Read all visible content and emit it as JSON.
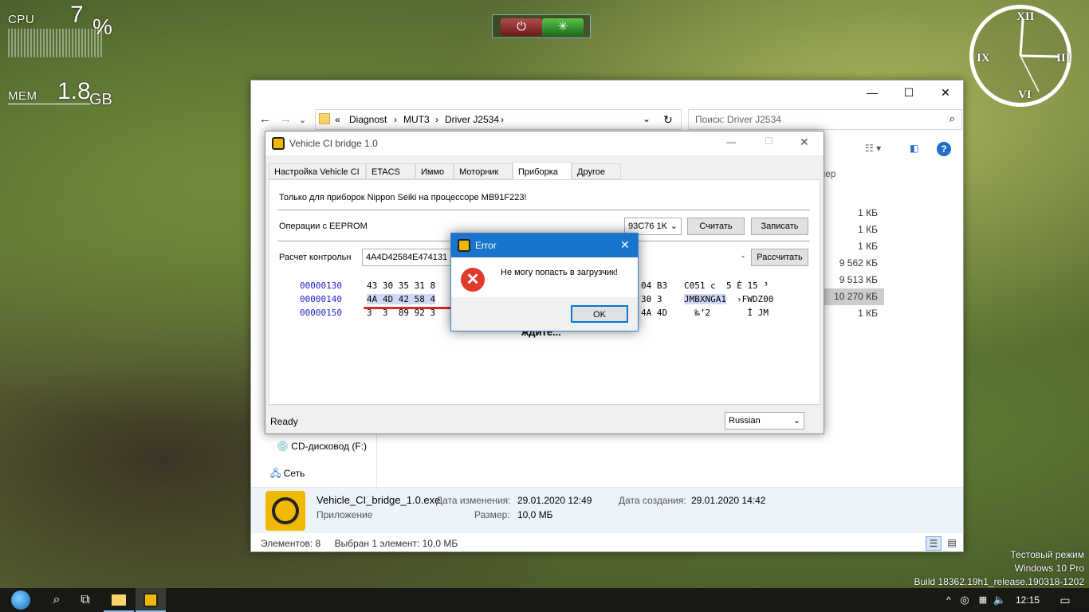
{
  "desktop": {
    "cpu": {
      "label": "CPU",
      "value": "7",
      "unit": "%"
    },
    "mem": {
      "label": "MEM",
      "value": "1.8",
      "unit": "GB"
    },
    "watermark": {
      "line1": "Тестовый режим",
      "line2": "Windows 10 Pro",
      "line3": "Build 18362.19h1_release.190318-1202"
    }
  },
  "explorer": {
    "breadcrumb_prefix": "«",
    "breadcrumb": [
      "Diagnost",
      "MUT3",
      "Driver J2534"
    ],
    "search_placeholder": "Поиск: Driver J2534",
    "col_size_partial": "мер",
    "sizes": [
      "1 КБ",
      "1 КБ",
      "1 КБ",
      "9 562 КБ",
      "9 513 КБ",
      "10 270 КБ",
      "1 КБ"
    ],
    "nav_items": [
      {
        "label": "CD-дисковод (F:)"
      },
      {
        "label": "Сеть"
      }
    ],
    "details": {
      "filename": "Vehicle_CI_bridge_1.0.exe",
      "type": "Приложение",
      "modified_label": "Дата изменения:",
      "modified_value": "29.01.2020 12:49",
      "created_label": "Дата создания:",
      "created_value": "29.01.2020 14:42",
      "size_label": "Размер:",
      "size_value": "10,0 МБ"
    },
    "status": {
      "items": "Элементов: 8",
      "selected": "Выбран 1 элемент: 10,0 МБ"
    }
  },
  "vci": {
    "title": "Vehicle CI bridge  1.0",
    "tabs": [
      "Настройка Vehicle CI",
      "ETACS",
      "Иммо",
      "Моторник",
      "Приборка",
      "Другое"
    ],
    "active_tab": "Приборка",
    "notice": "Только для приборок Nippon Seiki на процессоре MB91F223!",
    "eeprom_label": "Операции с EEPROM",
    "eeprom_chip": "93C76 1K",
    "read_button": "Считать",
    "write_button": "Записать",
    "checksum_label": "Расчет контрольн",
    "checksum_value": "4A4D42584E474131",
    "checksum_dash": "-",
    "calc_button": "Рассчитать",
    "hex_rows": [
      {
        "addr": "00000130",
        "bytes_left": "43 30 35 31 8",
        "bytes_right": "04 B3",
        "ascii_hl": "",
        "ascii": "C051 c  5 È 15 ³"
      },
      {
        "addr": "00000140",
        "bytes_left": "4A 4D 42 58 4",
        "bytes_right": "30 3",
        "ascii_hl": "JMBXNGA1",
        "ascii": "›FWDZ00"
      },
      {
        "addr": "00000150",
        "bytes_left": "3  3  89 92 3",
        "bytes_right": "4A 4D",
        "ascii_hl": "",
        "ascii": "  ‰’2       Ì JM"
      }
    ],
    "wait_text": "ждите...",
    "status": "Ready",
    "language": "Russian"
  },
  "error_dialog": {
    "title": "Error",
    "message": "Не могу попасть в загрузчик!",
    "ok_button": "OK"
  },
  "taskbar": {
    "time": "12:15"
  }
}
